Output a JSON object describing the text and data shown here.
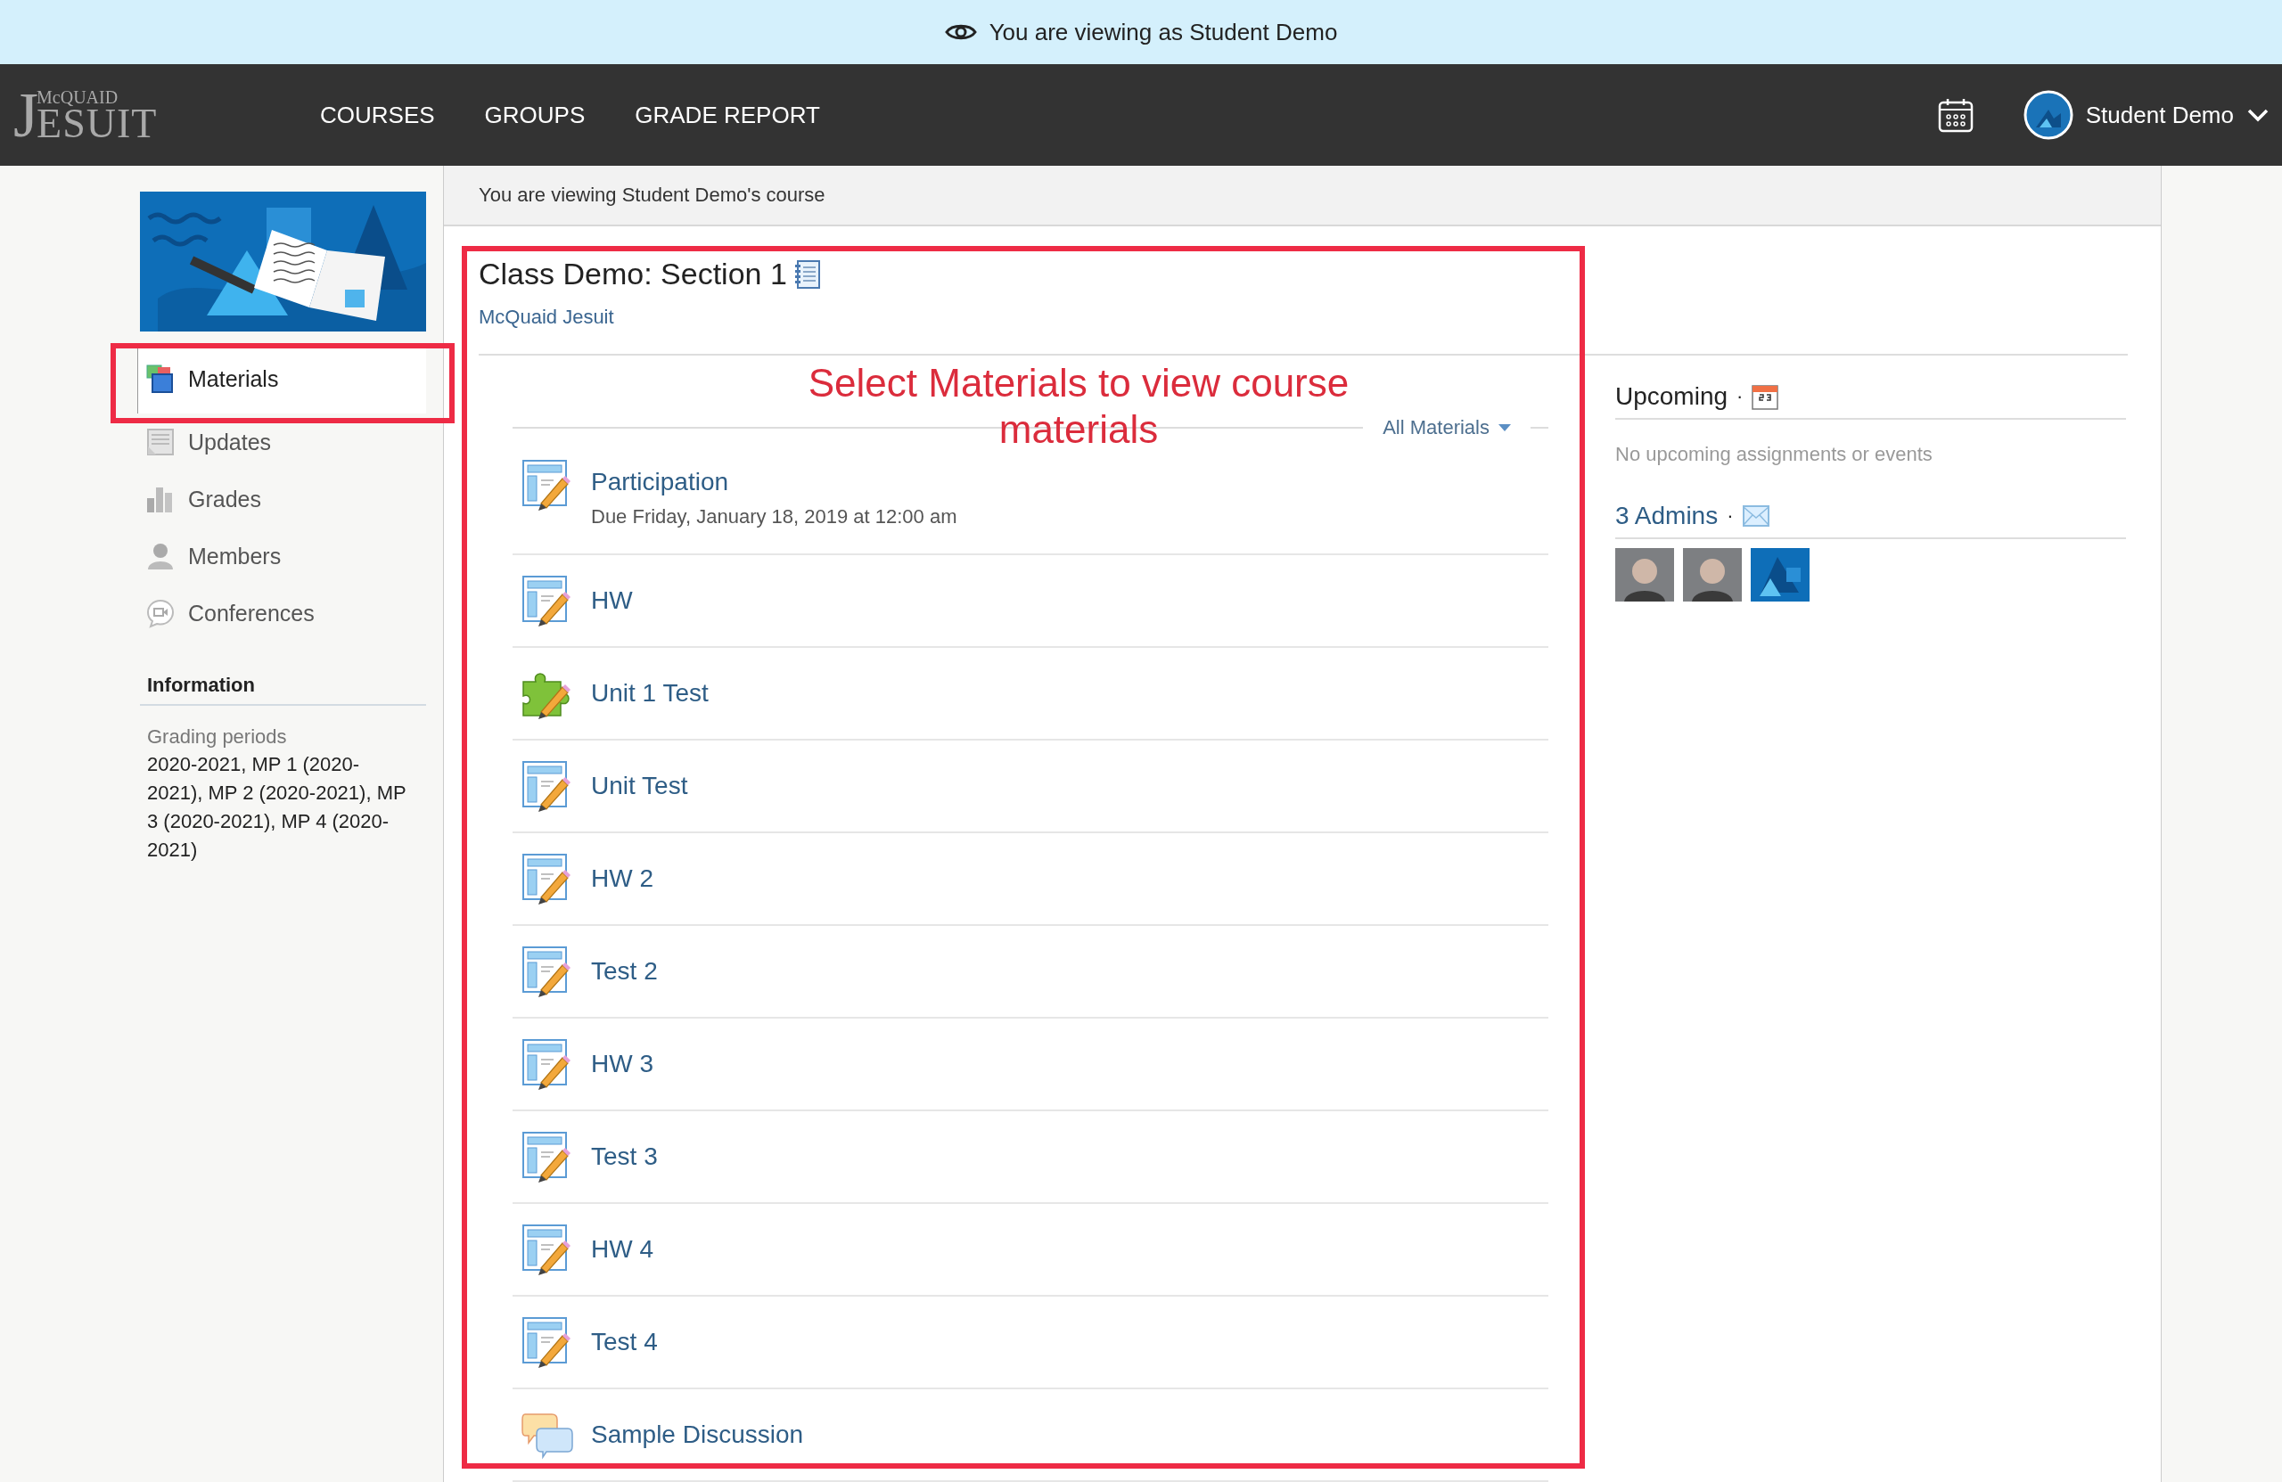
{
  "banner": {
    "text": "You are viewing as Student Demo"
  },
  "logo": {
    "initial": "J",
    "top": "McQUAID",
    "bottom": "ESUIT"
  },
  "nav": {
    "links": [
      "COURSES",
      "GROUPS",
      "GRADE REPORT"
    ],
    "user": "Student Demo"
  },
  "sidebar": {
    "items": [
      {
        "label": "Materials",
        "selected": true
      },
      {
        "label": "Updates",
        "selected": false
      },
      {
        "label": "Grades",
        "selected": false
      },
      {
        "label": "Members",
        "selected": false
      },
      {
        "label": "Conferences",
        "selected": false
      }
    ],
    "info_title": "Information",
    "info_label": "Grading periods",
    "info_text": "2020-2021, MP 1 (2020-2021), MP 2 (2020-2021), MP 3 (2020-2021), MP 4 (2020-2021)"
  },
  "notice": "You are viewing Student Demo's course",
  "course": {
    "title": "Class Demo: Section 1",
    "school": "McQuaid Jesuit"
  },
  "filter": "All Materials",
  "materials": [
    {
      "kind": "assignment",
      "title": "Participation",
      "due": "Due Friday, January 18, 2019 at 12:00 am"
    },
    {
      "kind": "assignment",
      "title": "HW"
    },
    {
      "kind": "assessment",
      "title": "Unit 1 Test"
    },
    {
      "kind": "assignment",
      "title": "Unit Test"
    },
    {
      "kind": "assignment",
      "title": "HW 2"
    },
    {
      "kind": "assignment",
      "title": "Test 2"
    },
    {
      "kind": "assignment",
      "title": "HW 3"
    },
    {
      "kind": "assignment",
      "title": "Test 3"
    },
    {
      "kind": "assignment",
      "title": "HW 4"
    },
    {
      "kind": "assignment",
      "title": "Test 4"
    },
    {
      "kind": "discussion",
      "title": "Sample Discussion"
    }
  ],
  "upcoming": {
    "title": "Upcoming",
    "separator": "·",
    "empty": "No upcoming assignments or events"
  },
  "admins": {
    "title": "3 Admins",
    "separator": "·",
    "avatars": [
      {
        "kind": "person"
      },
      {
        "kind": "person"
      },
      {
        "kind": "picture"
      }
    ]
  },
  "annotation": {
    "text": "Select Materials to view course materials"
  }
}
